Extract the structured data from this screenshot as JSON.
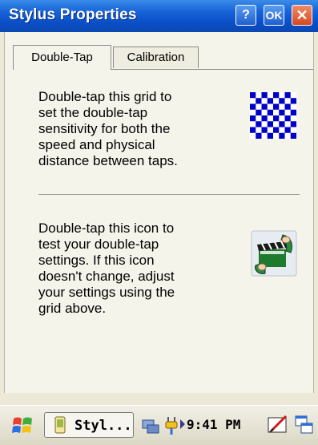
{
  "window": {
    "title": "Stylus Properties",
    "help_label": "?",
    "ok_label": "OK",
    "close_label": "✕"
  },
  "tabs": [
    {
      "label": "Double-Tap"
    },
    {
      "label": "Calibration"
    }
  ],
  "doubletap": {
    "grid_text": "Double-tap this grid to\nset the double-tap\nsensitivity for both the\nspeed and physical\ndistance between taps.",
    "icon_text": "Double-tap this icon to\ntest your double-tap\nsettings. If this icon\ndoesn't change, adjust\nyour settings using the\ngrid above."
  },
  "taskbar": {
    "task_label": "Styl...",
    "clock": "9:41 PM"
  },
  "colors": {
    "titlebar": "#0a4fc8",
    "grid_blue": "#0000c8",
    "close": "#d8481e"
  }
}
